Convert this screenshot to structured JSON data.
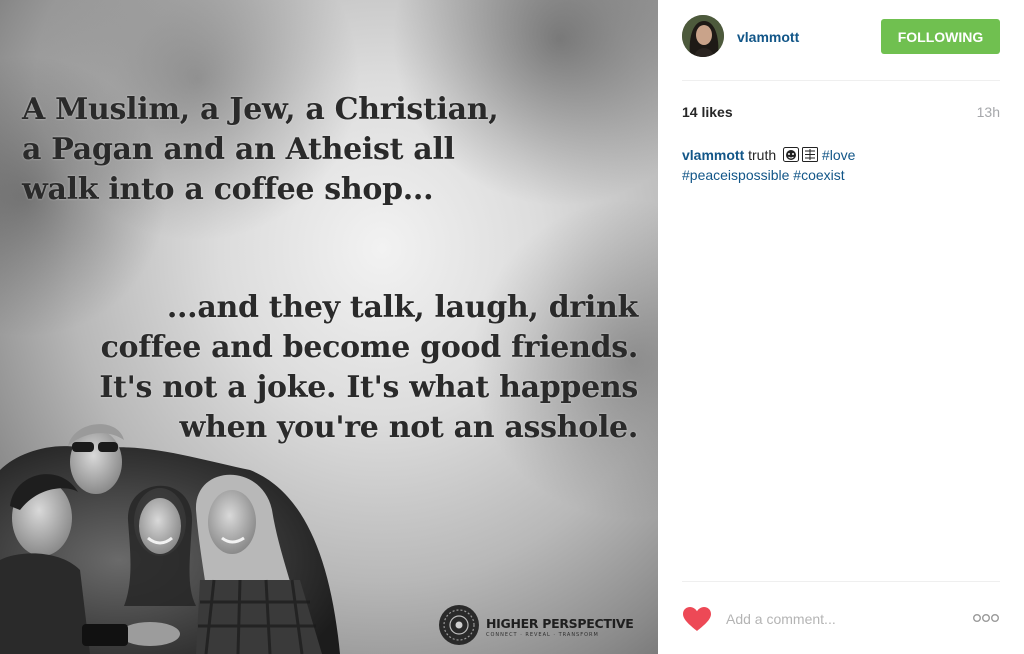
{
  "post": {
    "quote_top": [
      "A Muslim, a Jew, a Christian,",
      "a Pagan and an Atheist all",
      "walk into a coffee shop..."
    ],
    "quote_bottom": [
      "...and they talk, laugh, drink",
      "coffee and become good friends.",
      "It's not a joke. It's what happens",
      "when you're not an asshole."
    ],
    "brand_name": "HIGHER PERSPECTIVE",
    "brand_tagline": "CONNECT · REVEAL · TRANSFORM"
  },
  "header": {
    "username": "vlammott",
    "follow_label": "Following",
    "follow_color": "#70c050",
    "username_color": "#125688"
  },
  "meta": {
    "likes": "14 likes",
    "time": "13h"
  },
  "caption": {
    "username": "vlammott",
    "text": "truth",
    "emojis": [
      "face-icon",
      "gif-box-icon"
    ],
    "hashtags": [
      "#love",
      "#peaceispossible",
      "#coexist"
    ]
  },
  "comment": {
    "placeholder": "Add a comment...",
    "heart_color": "#ed4956"
  }
}
